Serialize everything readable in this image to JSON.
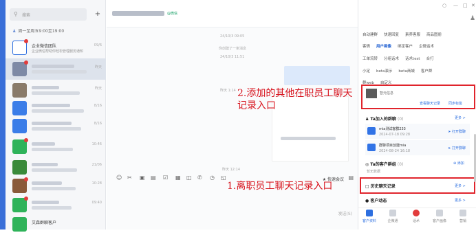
{
  "colors": {
    "accent": "#3a6fd8",
    "annotation": "#d8141e",
    "link": "#2d6fe0",
    "badge": "#e23c3c"
  },
  "sidebar": {
    "search_placeholder": "搜索",
    "plus_label": "+",
    "work_hours": "周一至周五9:00至19:00",
    "conversations": [
      {
        "name": "企业微信团队",
        "preview": "企业微信帮助你轻松管理服务通知",
        "time": "09/6",
        "avatar_color": "#ffffff",
        "badge": true
      },
      {
        "name": "",
        "preview": "",
        "time": "昨天",
        "avatar_color": "#7e8aa6",
        "badge": true
      },
      {
        "name": "",
        "preview": "",
        "time": "昨天",
        "avatar_color": "#8a7b6a",
        "badge": false
      },
      {
        "name": "",
        "preview": "",
        "time": "8/16",
        "avatar_color": "#3b7de8",
        "badge": false
      },
      {
        "name": "",
        "preview": "",
        "time": "8/16",
        "avatar_color": "#3b7de8",
        "badge": false
      },
      {
        "name": "",
        "preview": "",
        "time": "10:46",
        "avatar_color": "#2fb35a",
        "badge": true
      },
      {
        "name": "",
        "preview": "",
        "time": "21/06",
        "avatar_color": "#3a8a3a",
        "badge": false
      },
      {
        "name": "",
        "preview": "",
        "time": "10:28",
        "avatar_color": "#8a5a3a",
        "badge": true
      },
      {
        "name": "",
        "preview": "",
        "time": "09:40",
        "avatar_color": "#2fb35a",
        "badge": true
      },
      {
        "name": "艾森群聊客户",
        "preview": "",
        "time": "",
        "avatar_color": "#2fb35a",
        "badge": false
      }
    ]
  },
  "chat": {
    "title_tag": "@微信",
    "timestamps": [
      "24/10/3 09:05",
      "24/10/3 11:51",
      "昨天 1:14",
      "昨天 12:14"
    ],
    "system_msg": "你创建了一条消息",
    "quick_meeting": "快速会议",
    "send_label": "发送(S)"
  },
  "annotations": {
    "note2": "2.添加的其他在职员工聊天记录入口",
    "note1": "1.离职员工聊天记录入口"
  },
  "panel": {
    "tabs_row1": [
      "自动建群",
      "快速回复",
      "素养客服",
      "商品图册"
    ],
    "tabs_row2": [
      "客情",
      "用户画像",
      "绑定客户",
      "企微话术"
    ],
    "tabs_row3": [
      "工单流转",
      "分组话术",
      "话术test",
      "合打"
    ],
    "tabs_row4": [
      "小定",
      "beta演示",
      "beta商城",
      "客户群"
    ],
    "tabs_row5": [
      "群web",
      "自定义"
    ],
    "profile_name": "智元信息",
    "profile_link1": "查看聊天记录",
    "profile_link2": "同步标签",
    "groups_title": "Ta加入的群聊",
    "groups_count": "(0)",
    "groups_more": "更多 >",
    "groups": [
      {
        "name": "mia测试客群233",
        "date": "2024-07-18 09:28",
        "open": "打开群聊"
      },
      {
        "name": "群聊项目创建mia",
        "date": "2024-08-24 16:18",
        "open": "打开群聊"
      }
    ],
    "cust_groups_title": "Ta的客户群组",
    "cust_groups_count": "(0)",
    "cust_groups_add": "添加",
    "cust_groups_empty": "暂无数据",
    "history_title": "历史聊天记录",
    "history_more": "更多 >",
    "dynamics_title": "客户动态",
    "dynamics_more": "更多 >",
    "bottom_nav": [
      "客户资料",
      "企微通",
      "话术",
      "客户画像",
      "营销"
    ]
  }
}
